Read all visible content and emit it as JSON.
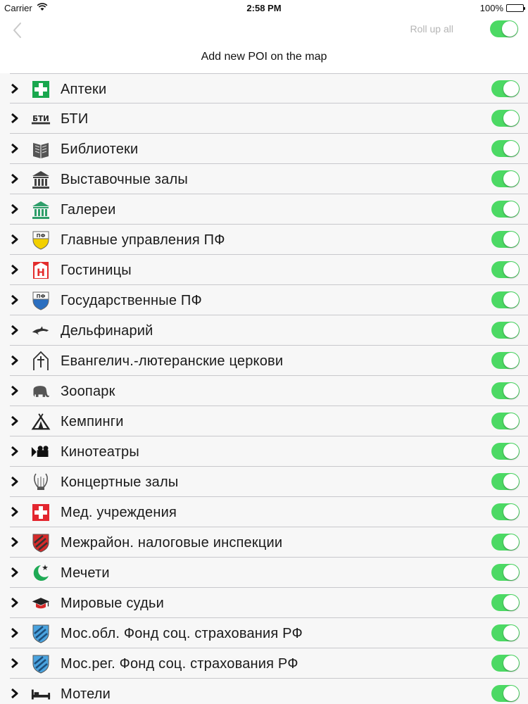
{
  "status": {
    "carrier": "Carrier",
    "time": "2:58 PM",
    "battery": "100%"
  },
  "nav": {
    "rollup_label": "Roll up all",
    "rollup_on": true
  },
  "header": {
    "subtitle": "Add new POI on the map"
  },
  "colors": {
    "switch_on": "#4cd964"
  },
  "categories": [
    {
      "label": "Аптеки",
      "icon": "pharmacy-cross-icon",
      "enabled": true
    },
    {
      "label": "БТИ",
      "icon": "bti-text-icon",
      "icon_text": "БТИ",
      "enabled": true
    },
    {
      "label": "Библиотеки",
      "icon": "library-book-icon",
      "enabled": true
    },
    {
      "label": "Выставочные залы",
      "icon": "exhibition-columns-icon",
      "enabled": true
    },
    {
      "label": "Галереи",
      "icon": "gallery-columns-icon",
      "enabled": true
    },
    {
      "label": "Главные управления ПФ",
      "icon": "pension-fund-yellow-shield-icon",
      "icon_text": "ПФ",
      "enabled": true
    },
    {
      "label": "Гостиницы",
      "icon": "hotel-h-icon",
      "icon_text": "H",
      "enabled": true
    },
    {
      "label": "Государственные ПФ",
      "icon": "pension-fund-blue-shield-icon",
      "icon_text": "ПФ",
      "enabled": true
    },
    {
      "label": "Дельфинарий",
      "icon": "dolphin-icon",
      "enabled": true
    },
    {
      "label": "Евангелич.-лютеранские церкови",
      "icon": "lutheran-church-icon",
      "enabled": true
    },
    {
      "label": "Зоопарк",
      "icon": "elephant-icon",
      "enabled": true
    },
    {
      "label": "Кемпинги",
      "icon": "camping-tent-icon",
      "enabled": true
    },
    {
      "label": "Кинотеатры",
      "icon": "movie-camera-icon",
      "enabled": true
    },
    {
      "label": "Концертные залы",
      "icon": "lyre-icon",
      "enabled": true
    },
    {
      "label": "Мед. учреждения",
      "icon": "medical-cross-icon",
      "enabled": true
    },
    {
      "label": "Межрайон. налоговые инспекции",
      "icon": "tax-red-shield-icon",
      "enabled": true
    },
    {
      "label": "Мечети",
      "icon": "crescent-star-icon",
      "enabled": true
    },
    {
      "label": "Мировые судьи",
      "icon": "graduation-cap-icon",
      "enabled": true
    },
    {
      "label": "Мос.обл. Фонд соц. страхования РФ",
      "icon": "social-fund-shield-icon",
      "enabled": true
    },
    {
      "label": "Мос.рег. Фонд соц. страхования РФ",
      "icon": "social-fund-shield-icon",
      "enabled": true
    },
    {
      "label": "Мотели",
      "icon": "bed-icon",
      "enabled": true
    }
  ]
}
